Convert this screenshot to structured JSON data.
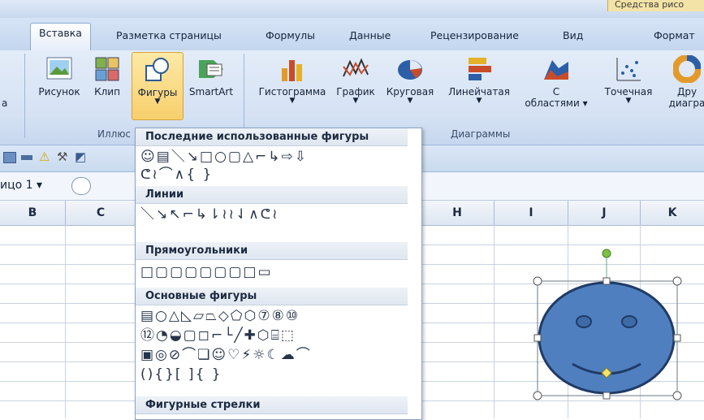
{
  "ribbon_context_title": "Средства рисо",
  "tabs": [
    {
      "label": "Вставка",
      "active": true
    },
    {
      "label": "Разметка страницы"
    },
    {
      "label": "Формулы"
    },
    {
      "label": "Данные"
    },
    {
      "label": "Рецензирование"
    },
    {
      "label": "Вид"
    },
    {
      "label": "Формат"
    }
  ],
  "ribbon": {
    "left_cut_label": "а",
    "buttons": {
      "picture": "Рисунок",
      "clip": "Клип",
      "shapes": "Фигуры",
      "smartart": "SmartArt",
      "histogram": "Гистограмма",
      "graph": "График",
      "pie": "Круговая",
      "bar": "Линейчатая",
      "area_line1": "С",
      "area_line2": "областями",
      "scatter": "Точечная",
      "other_line1": "Дру",
      "other_line2": "диагра"
    },
    "group_illustrations": "Иллюс",
    "group_charts": "Диаграммы"
  },
  "name_box": "ицо 1",
  "columns": [
    "B",
    "C",
    "H",
    "I",
    "J",
    "K"
  ],
  "shapes_menu": {
    "sections": {
      "recent": "Последние использованные фигуры",
      "lines": "Линии",
      "rectangles": "Прямоугольники",
      "basic": "Основные фигуры",
      "arrows": "Фигурные стрелки"
    },
    "recent_row1": "☺▤＼↘□○▢△⌐↳⇨⇩",
    "recent_row2": "ᕦ≀⌒∧{ }",
    "lines_row": "＼↘↖⌐↳⇂≀≀⇃∧ᕦ≀",
    "rect_row": "□▢▢▢▢▢▢□▭",
    "basic_row1": "▤○△◺▱⏢◇⬠⬡⑦⑧⑩",
    "basic_row2": "⑫◔◒▢◻⌐└╱✚⬡⌸⬚",
    "basic_row3": "▣◎⊘⌒❏☺♡⚡☼☾☁⌒",
    "basic_row4": "(){}[ ]{ }"
  },
  "colors": {
    "smiley_fill": "#4f7fbf",
    "smiley_stroke": "#1f3b66",
    "handle_green": "#7ec242",
    "handle_yellow": "#f6e36a"
  }
}
